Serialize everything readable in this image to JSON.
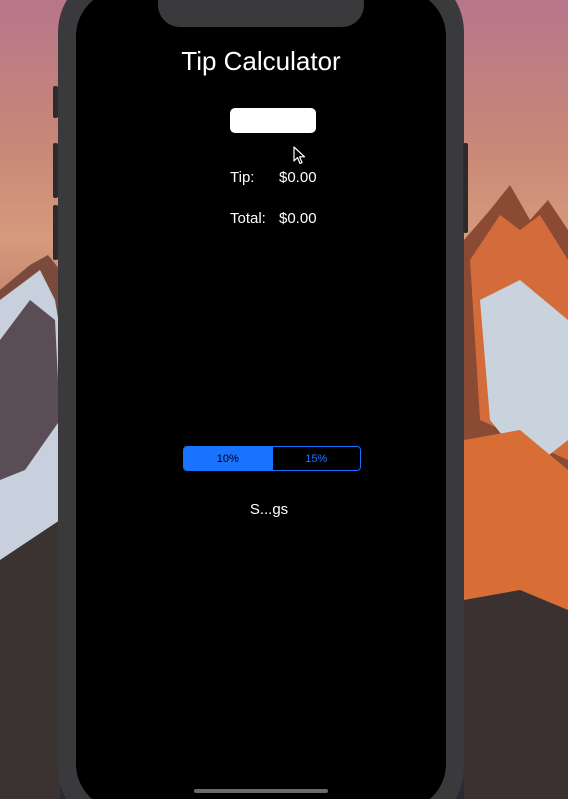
{
  "app": {
    "title": "Tip Calculator"
  },
  "bill_input": {
    "value": "",
    "placeholder": ""
  },
  "results": {
    "tip_label": "Tip:",
    "tip_value": "$0.00",
    "total_label": "Total:",
    "total_value": "$0.00"
  },
  "tip_options": {
    "segments": [
      {
        "label": "10%",
        "selected": true
      },
      {
        "label": "15%",
        "selected": false
      }
    ]
  },
  "settings_button": {
    "label": "S...gs"
  },
  "colors": {
    "accent": "#1a73ff",
    "screen_background": "#000000",
    "text": "#ffffff"
  }
}
